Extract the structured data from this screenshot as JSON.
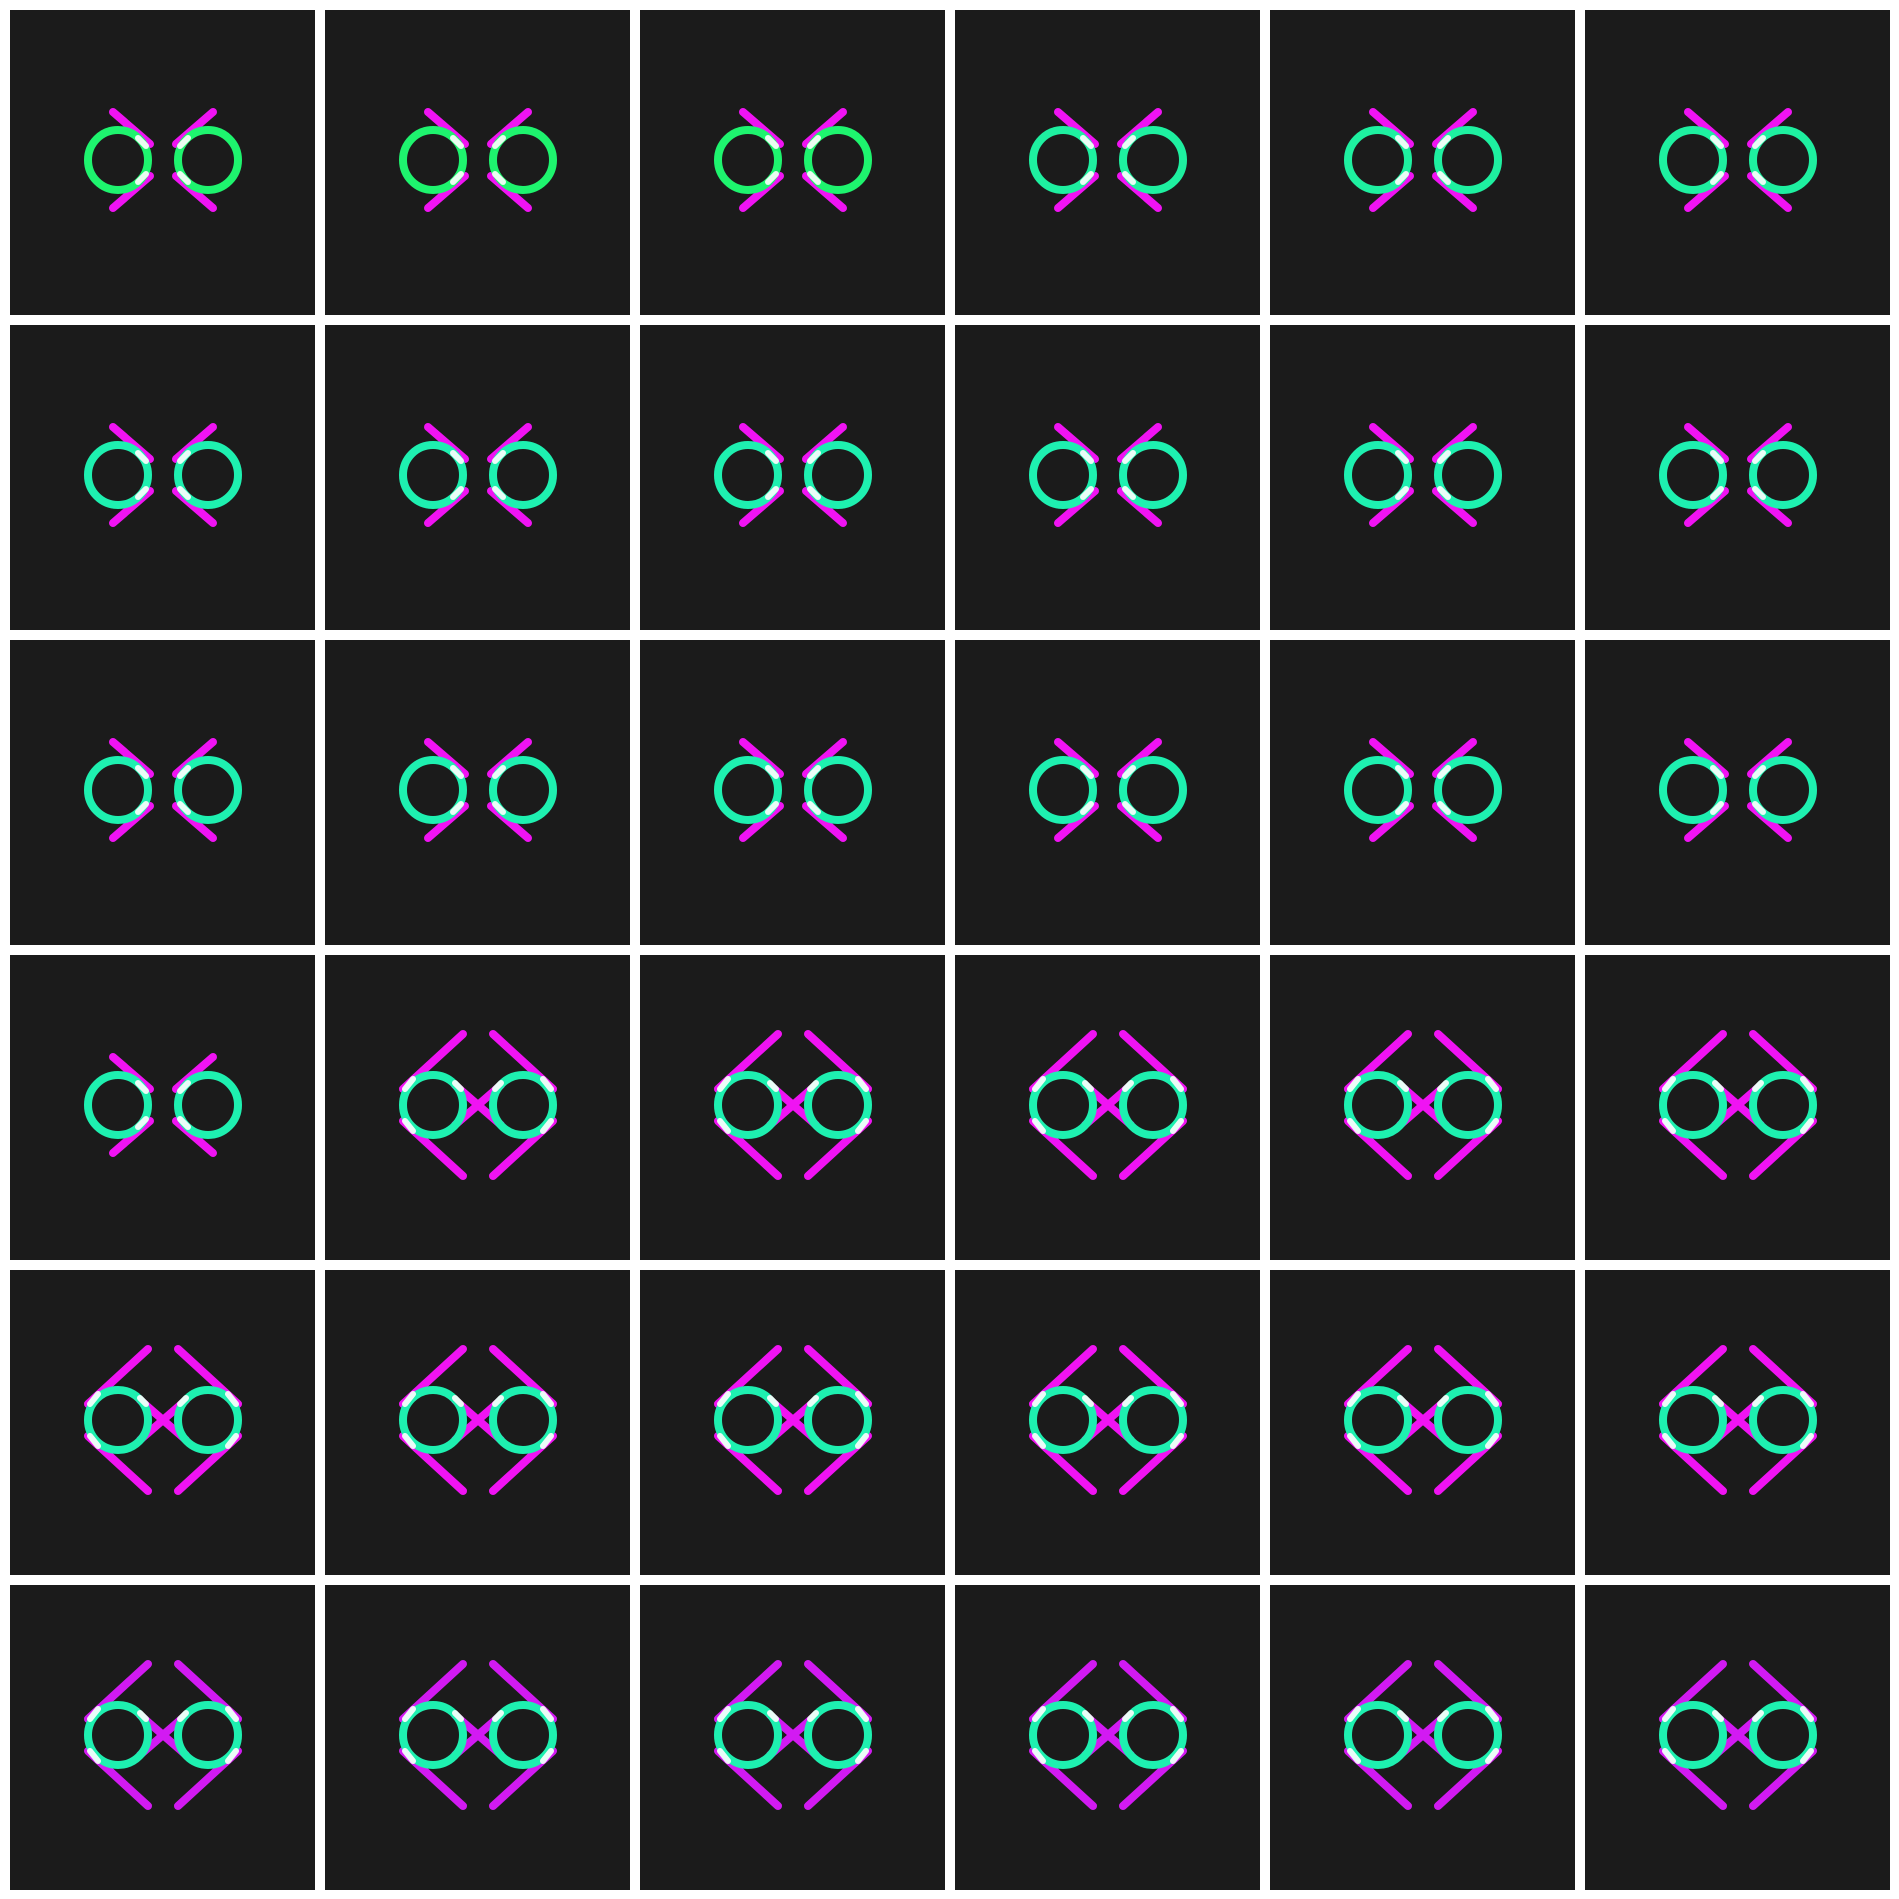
{
  "grid": {
    "rows": 6,
    "columns": 6,
    "page_background": "#ffffff",
    "tile_background": "#1b1b1b"
  },
  "frames": [
    {
      "ring_color": "#1ef46e",
      "chevron_color": "#f013f3",
      "highlight_color": "#ffffff",
      "chevron_spread": 0.0
    },
    {
      "ring_color": "#1ef46e",
      "chevron_color": "#f013f3",
      "highlight_color": "#ffffff",
      "chevron_spread": 0.0
    },
    {
      "ring_color": "#1ef46e",
      "chevron_color": "#f013f3",
      "highlight_color": "#ffffff",
      "chevron_spread": 0.0
    },
    {
      "ring_color": "#1ef0a0",
      "chevron_color": "#f013f3",
      "highlight_color": "#ffffff",
      "chevron_spread": 0.0
    },
    {
      "ring_color": "#1ef0a0",
      "chevron_color": "#f013f3",
      "highlight_color": "#ffffff",
      "chevron_spread": 0.0
    },
    {
      "ring_color": "#1ef0a0",
      "chevron_color": "#f013f3",
      "highlight_color": "#ffffff",
      "chevron_spread": 0.0
    },
    {
      "ring_color": "#1ef0b0",
      "chevron_color": "#f013f3",
      "highlight_color": "#ffffff",
      "chevron_spread": 0.0
    },
    {
      "ring_color": "#1ef0b0",
      "chevron_color": "#f013f3",
      "highlight_color": "#ffffff",
      "chevron_spread": 0.0
    },
    {
      "ring_color": "#1ef0b0",
      "chevron_color": "#f013f3",
      "highlight_color": "#ffffff",
      "chevron_spread": 0.0
    },
    {
      "ring_color": "#1ef0b0",
      "chevron_color": "#f013f3",
      "highlight_color": "#ffffff",
      "chevron_spread": 0.0
    },
    {
      "ring_color": "#1ef0b0",
      "chevron_color": "#f013f3",
      "highlight_color": "#ffffff",
      "chevron_spread": 0.0
    },
    {
      "ring_color": "#1ef0b0",
      "chevron_color": "#f013f3",
      "highlight_color": "#ffffff",
      "chevron_spread": 0.0
    },
    {
      "ring_color": "#1ef0b0",
      "chevron_color": "#f013f3",
      "highlight_color": "#ffffff",
      "chevron_spread": 0.0
    },
    {
      "ring_color": "#1ef0b0",
      "chevron_color": "#f013f3",
      "highlight_color": "#ffffff",
      "chevron_spread": 0.0
    },
    {
      "ring_color": "#1ef0b0",
      "chevron_color": "#f013f3",
      "highlight_color": "#ffffff",
      "chevron_spread": 0.0
    },
    {
      "ring_color": "#1ef0b0",
      "chevron_color": "#f013f3",
      "highlight_color": "#ffffff",
      "chevron_spread": 0.0
    },
    {
      "ring_color": "#1ef0b0",
      "chevron_color": "#f013f3",
      "highlight_color": "#ffffff",
      "chevron_spread": 0.0
    },
    {
      "ring_color": "#1ef0b0",
      "chevron_color": "#f013f3",
      "highlight_color": "#ffffff",
      "chevron_spread": 0.0
    },
    {
      "ring_color": "#1ef0b0",
      "chevron_color": "#f013f3",
      "highlight_color": "#ffffff",
      "chevron_spread": 0.0
    },
    {
      "ring_color": "#1ef0b0",
      "chevron_color": "#f013f3",
      "highlight_color": "#ffffff",
      "chevron_spread": 1.0
    },
    {
      "ring_color": "#1ef0b0",
      "chevron_color": "#f013f3",
      "highlight_color": "#ffffff",
      "chevron_spread": 1.0
    },
    {
      "ring_color": "#1ef0b0",
      "chevron_color": "#f013f3",
      "highlight_color": "#ffffff",
      "chevron_spread": 1.0
    },
    {
      "ring_color": "#1ef0b0",
      "chevron_color": "#f013f3",
      "highlight_color": "#ffffff",
      "chevron_spread": 1.0
    },
    {
      "ring_color": "#1ef0b0",
      "chevron_color": "#f013f3",
      "highlight_color": "#ffffff",
      "chevron_spread": 1.0
    },
    {
      "ring_color": "#1ef0b0",
      "chevron_color": "#f013f3",
      "highlight_color": "#ffffff",
      "chevron_spread": 1.0
    },
    {
      "ring_color": "#1ef0b0",
      "chevron_color": "#f013f3",
      "highlight_color": "#ffffff",
      "chevron_spread": 1.0
    },
    {
      "ring_color": "#1ef0b0",
      "chevron_color": "#f013f3",
      "highlight_color": "#ffffff",
      "chevron_spread": 1.0
    },
    {
      "ring_color": "#1ef0b0",
      "chevron_color": "#f013f3",
      "highlight_color": "#ffffff",
      "chevron_spread": 1.0
    },
    {
      "ring_color": "#1ef0b0",
      "chevron_color": "#f013f3",
      "highlight_color": "#ffffff",
      "chevron_spread": 1.0
    },
    {
      "ring_color": "#1ef0b0",
      "chevron_color": "#f013f3",
      "highlight_color": "#ffffff",
      "chevron_spread": 1.0
    },
    {
      "ring_color": "#1ef0b0",
      "chevron_color": "#d21af2",
      "highlight_color": "#ffffff",
      "chevron_spread": 1.0
    },
    {
      "ring_color": "#1ef0b0",
      "chevron_color": "#d21af2",
      "highlight_color": "#ffffff",
      "chevron_spread": 1.0
    },
    {
      "ring_color": "#1ef0b0",
      "chevron_color": "#d21af2",
      "highlight_color": "#ffffff",
      "chevron_spread": 1.0
    },
    {
      "ring_color": "#1ef0b0",
      "chevron_color": "#d21af2",
      "highlight_color": "#ffffff",
      "chevron_spread": 1.0
    },
    {
      "ring_color": "#1ef0b0",
      "chevron_color": "#d21af2",
      "highlight_color": "#ffffff",
      "chevron_spread": 1.0
    },
    {
      "ring_color": "#1ef0b0",
      "chevron_color": "#d21af2",
      "highlight_color": "#ffffff",
      "chevron_spread": 1.0
    }
  ]
}
